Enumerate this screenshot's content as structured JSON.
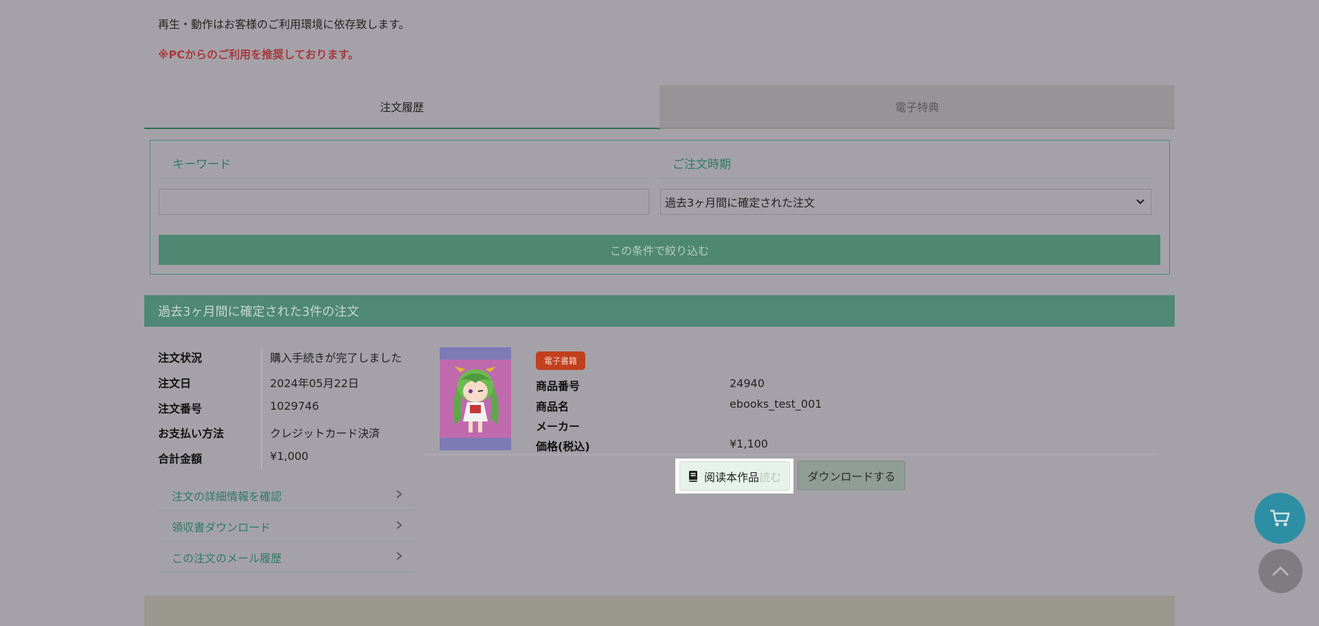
{
  "notice": {
    "environment": "再生・動作はお客様のご利用環境に依存致します。",
    "pc_recommend": "※PCからのご利用を推奨しております。"
  },
  "tabs": [
    {
      "label": "注文履歴",
      "active": true
    },
    {
      "label": "電子特典",
      "active": false
    }
  ],
  "filter": {
    "keyword_label": "キーワード",
    "keyword_value": "",
    "period_label": "ご注文時期",
    "period_selected": "過去3ヶ月間に確定された注文",
    "submit_label": "この条件で絞り込む"
  },
  "results": {
    "header": "過去3ヶ月間に確定された3件の注文"
  },
  "order": {
    "fields": [
      {
        "label": "注文状況",
        "value": "購入手続きが完了しました"
      },
      {
        "label": "注文日",
        "value": "2024年05月22日"
      },
      {
        "label": "注文番号",
        "value": "1029746"
      },
      {
        "label": "お支払い方法",
        "value": "クレジットカード決済"
      },
      {
        "label": "合計金額",
        "value": "¥1,000"
      }
    ],
    "links": [
      {
        "label": "注文の詳細情報を確認"
      },
      {
        "label": "領収書ダウンロード"
      },
      {
        "label": "この注文のメール履歴"
      }
    ]
  },
  "product": {
    "badge": "電子書籍",
    "fields": [
      {
        "label": "商品番号",
        "value": "24940"
      },
      {
        "label": "商品名",
        "value": "ebooks_test_001"
      },
      {
        "label": "メーカー",
        "value": ""
      },
      {
        "label": "価格(税込)",
        "value": "¥1,100"
      }
    ],
    "read_button": {
      "label": "阅读本作品",
      "suffix": "読む"
    },
    "download_button": {
      "label": "ダウンロードする"
    }
  },
  "colors": {
    "accent": "#4e8872",
    "warning": "#a8383c",
    "badge": "#c2401e",
    "cart_fab": "#2e8ea4"
  },
  "icons": {
    "select": "chevron-down-icon",
    "link": "chevron-right-icon",
    "read": "book-icon",
    "cart": "cart-icon",
    "top": "chevron-up-icon"
  }
}
